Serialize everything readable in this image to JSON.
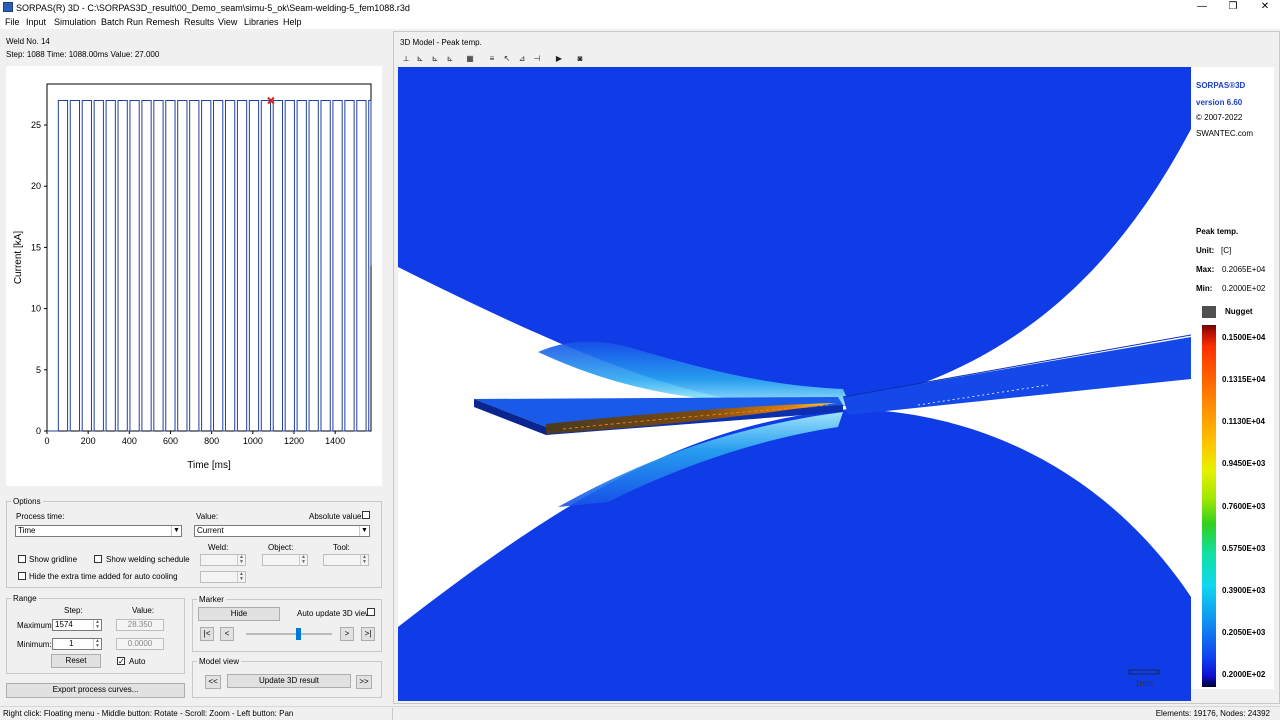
{
  "window": {
    "title": "SORPAS(R) 3D - C:\\SORPAS3D_result\\00_Demo_seam\\simu-5_ok\\Seam-welding-5_fem1088.r3d",
    "minimize": "—",
    "maximize": "❐",
    "close": "✕"
  },
  "menu": {
    "items": [
      "File",
      "Input",
      "Simulation",
      "Batch Run",
      "Remesh",
      "Results",
      "View",
      "Libraries",
      "Help"
    ]
  },
  "info": {
    "weld": "Weld No. 14",
    "step": "Step: 1088   Time: 1088.00ms   Value: 27.000"
  },
  "chart_data": {
    "type": "line",
    "title": "",
    "xlabel": "Time [ms]",
    "ylabel": "Current [kA]",
    "xlim": [
      0,
      1574
    ],
    "ylim": [
      0,
      28.35
    ],
    "x_ticks": [
      0,
      200,
      400,
      600,
      800,
      1000,
      1200,
      1400
    ],
    "y_ticks": [
      0,
      5,
      10,
      15,
      20,
      25
    ],
    "grid": false,
    "series": [
      {
        "description": "pulsed welding current",
        "pulses": {
          "start": 55,
          "on_ms": 45,
          "off_ms": 13,
          "count": 27,
          "amplitude": 27.0,
          "base": 0.0
        },
        "line_color": "#2040a0"
      }
    ],
    "marker": {
      "x": 1088,
      "y": 27.0,
      "symbol": "x",
      "color": "#cc2020"
    },
    "end_value": 13.5
  },
  "options": {
    "group_label": "Options",
    "process_time_label": "Process time:",
    "process_time_value": "Time",
    "value_label": "Value:",
    "value_value": "Current",
    "absolute_values_label": "Absolute values",
    "show_gridline": "Show gridline",
    "show_welding_schedule": "Show welding schedule",
    "hide_extra_time": "Hide the extra time added for auto cooling",
    "weld_label": "Weld:",
    "object_label": "Object:",
    "tool_label": "Tool:"
  },
  "range": {
    "group_label": "Range",
    "step_label": "Step:",
    "value_label": "Value:",
    "maximum_label": "Maximum:",
    "maximum_step": "1574",
    "maximum_value": "28.350",
    "minimum_label": "Minimum:",
    "minimum_step": "1",
    "minimum_value": "0.0000",
    "reset_label": "Reset",
    "auto_label": "Auto",
    "auto_checked": "✓"
  },
  "marker": {
    "group_label": "Marker",
    "hide_label": "Hide",
    "auto_update_label": "Auto update 3D view",
    "first": "|<",
    "prev": "<",
    "next": ">",
    "last": ">|",
    "slider_position": 0.6
  },
  "model_view": {
    "group_label": "Model view",
    "prev": "<<",
    "update_label": "Update 3D result",
    "next": ">>"
  },
  "export_label": "Export process curves...",
  "status": {
    "hint": "Right click: Floating menu  -  Middle button: Rotate  -  Scroll: Zoom  -  Left button: Pan",
    "counts": "Elements: 19176,  Nodes: 24392"
  },
  "panel3d": {
    "title": "3D Model - Peak temp.",
    "toolbar_icons": [
      "axis-xyz-icon",
      "view-xy-icon",
      "view-xz-icon",
      "view-yz-icon",
      "mesh-icon",
      "settings-icon",
      "pointer-icon",
      "graph-icon",
      "cut-icon",
      "play-icon",
      "camera-icon"
    ],
    "scale_label": "1mm"
  },
  "legend": {
    "brand": "SORPAS®3D",
    "version": "version 6.60",
    "copyright": "© 2007-2022",
    "website": "SWANTEC.com",
    "quantity": "Peak temp.",
    "unit_label": "Unit:",
    "unit_value": "[C]",
    "max_label": "Max:",
    "max_value": "0.2065E+04",
    "min_label": "Min:",
    "min_value": "0.2000E+02",
    "nugget_label": "Nugget",
    "ticks": [
      "0.1500E+04",
      "0.1315E+04",
      "0.1130E+04",
      "0.9450E+03",
      "0.7600E+03",
      "0.5750E+03",
      "0.3900E+03",
      "0.2050E+03",
      "0.2000E+02"
    ],
    "colors": {
      "nugget": "#505050",
      "top": "#700000",
      "bottom": "#000030"
    }
  }
}
